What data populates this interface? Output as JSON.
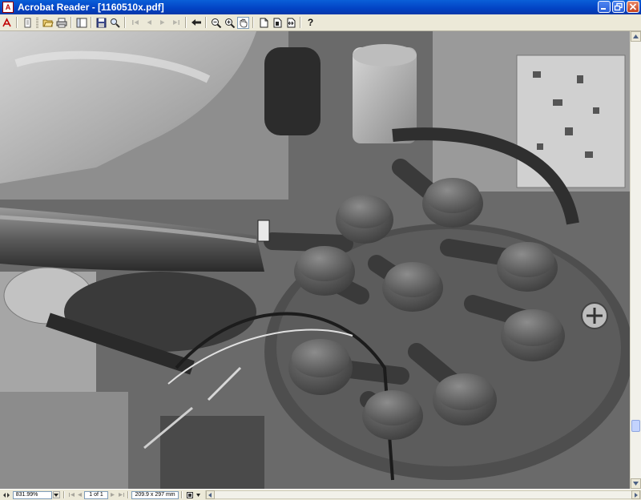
{
  "window": {
    "title": "Acrobat Reader - [1160510x.pdf]",
    "app_icon_glyph": "A"
  },
  "toolbar": {
    "icons": [
      "open-icon",
      "print-icon",
      "email-icon",
      "bookmarks-icon",
      "save-icon",
      "search-icon",
      "first-page-icon",
      "previous-page-icon",
      "next-page-icon",
      "last-page-icon",
      "go-back-icon",
      "zoom-out-icon",
      "zoom-in-icon",
      "hand-tool-icon",
      "actual-size-icon",
      "fit-page-icon",
      "fit-width-icon",
      "help-icon"
    ],
    "help_label": "?"
  },
  "document": {
    "description": "Black-and-white photo of an engine bay showing an ignition distributor cap with spark plug leads",
    "background_color": "#5e5e5e"
  },
  "statusbar": {
    "zoom": "831.99%",
    "page_indicator": "1 of 1",
    "page_size": "209.9 x 297 mm"
  },
  "colors": {
    "title_bar": "#0242c4",
    "chrome": "#ece9d8",
    "close_button": "#c5401c"
  }
}
